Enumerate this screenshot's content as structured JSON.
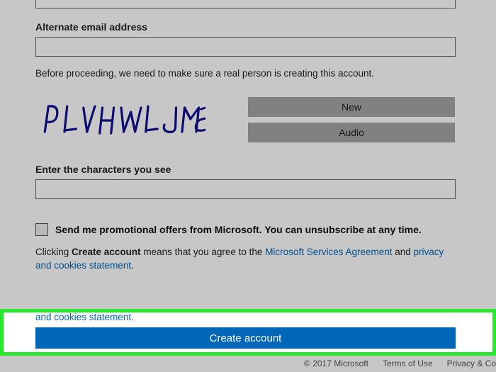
{
  "form": {
    "alt_email_label": "Alternate email address",
    "captcha_note": "Before proceeding, we need to make sure a real person is creating this account.",
    "captcha_text": "PLVHWLJMG",
    "captcha_new": "New",
    "captcha_audio": "Audio",
    "enter_chars_label": "Enter the characters you see",
    "promo_label": "Send me promotional offers from Microsoft. You can unsubscribe at any time.",
    "agree_prefix": "Clicking ",
    "agree_bold": "Create account",
    "agree_mid": " means that you agree to the ",
    "agree_link1": "Microsoft Services Agreement",
    "agree_and": " and ",
    "agree_link2": "privacy and cookies statement",
    "agree_suffix": ".",
    "cookies_tail": "and cookies statement.",
    "create_button": "Create account"
  },
  "footer": {
    "copyright": "© 2017 Microsoft",
    "terms": "Terms of Use",
    "privacy": "Privacy & Co"
  }
}
